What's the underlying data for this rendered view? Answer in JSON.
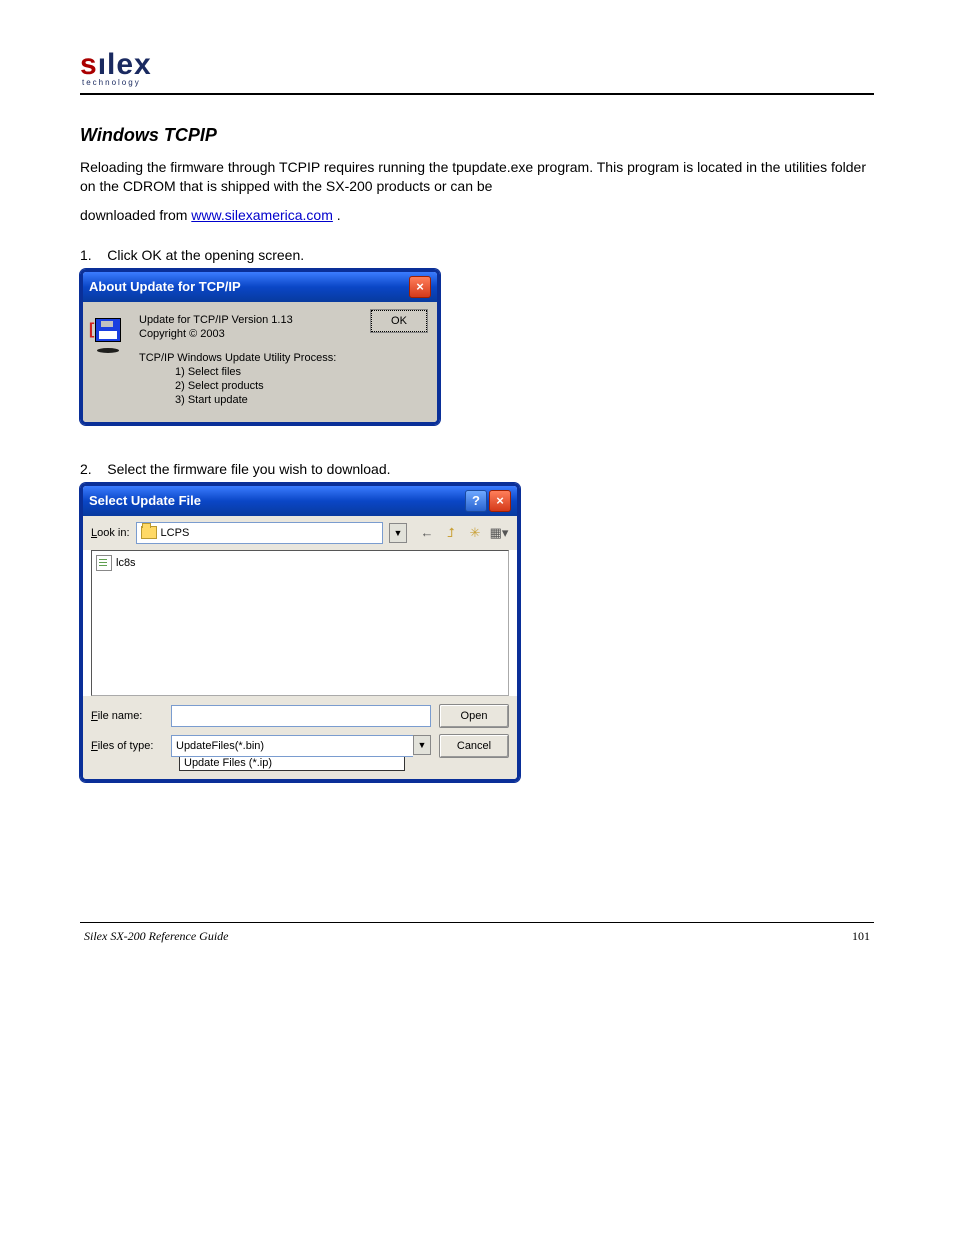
{
  "logo": {
    "text_s": "s",
    "text_rest": "ılex",
    "sub": "technology"
  },
  "section": {
    "title": "Windows TCPIP"
  },
  "intro": [
    "Reloading the firmware through TCPIP requires running the tpupdate.exe program. This program is located in the utilities folder on the CDROM that is shipped with the SX-200 products or can be",
    "Click OK at the opening screen."
  ],
  "download_prefix": "downloaded from ",
  "download_link": "www.silexamerica.com",
  "download_suffix": " .",
  "step1_prefix": "1.",
  "step1_suffix": "Click OK at the opening screen.",
  "about": {
    "title": "About Update for TCP/IP",
    "line1": "Update for TCP/IP Version 1.13",
    "line2": "Copyright © 2003",
    "line3": "TCP/IP Windows Update Utility Process:",
    "steps": [
      "1) Select files",
      "2) Select products",
      "3) Start update"
    ],
    "ok": "OK"
  },
  "step2_prefix": "2.",
  "step2_suffix": "Select the firmware file you wish to download.",
  "open": {
    "title": "Select Update File",
    "lookin_label": "Look in:",
    "lookin_value": "LCPS",
    "file_entry": "lc8s",
    "filename_label": "File name:",
    "filename_value": "",
    "filetype_label": "Files of type:",
    "filetype_value": "UpdateFiles(*.bin)",
    "dropdown_option": "Update Files (*.ip)",
    "btn_open": "Open",
    "btn_cancel": "Cancel"
  },
  "footer": {
    "left": "Silex SX-200 Reference Guide",
    "right": "101"
  }
}
